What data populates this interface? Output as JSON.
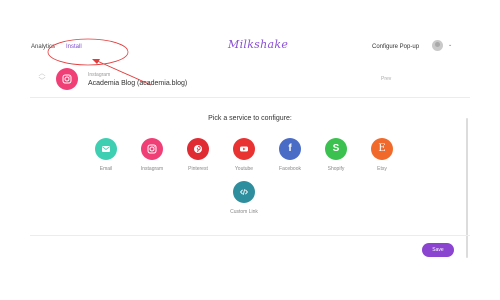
{
  "header": {
    "nav": [
      "Analytics",
      "Install"
    ],
    "brand": "Milkshake",
    "configure_label": "Configure Pop-up",
    "chevron": "⌄"
  },
  "row": {
    "subtitle": "Instagram",
    "title": "Academia Blog (academia.blog)",
    "right_label": "Prev"
  },
  "pick_title": "Pick a service to configure:",
  "services": [
    {
      "label": "Email",
      "icon": "email-icon",
      "color": "#3ecfb2"
    },
    {
      "label": "Instagram",
      "icon": "instagram-icon",
      "color": "#ef3f76"
    },
    {
      "label": "Pinterest",
      "icon": "pinterest-icon",
      "color": "#e12b32"
    },
    {
      "label": "Youtube",
      "icon": "youtube-icon",
      "color": "#e93232"
    },
    {
      "label": "Facebook",
      "icon": "facebook-icon",
      "color": "#4a6cc7"
    },
    {
      "label": "Shopify",
      "icon": "shopify-icon",
      "color": "#3ac14f"
    },
    {
      "label": "Etsy",
      "icon": "etsy-icon",
      "color": "#f26a2b"
    },
    {
      "label": "Custom Link",
      "icon": "code-icon",
      "color": "#2f8e9e"
    }
  ],
  "glyphs": {
    "facebook": "f",
    "shopify": "S",
    "etsy": "E"
  },
  "save_label": "Save",
  "colors": {
    "accent": "#8b44cf",
    "annotation": "#e23b3b"
  }
}
